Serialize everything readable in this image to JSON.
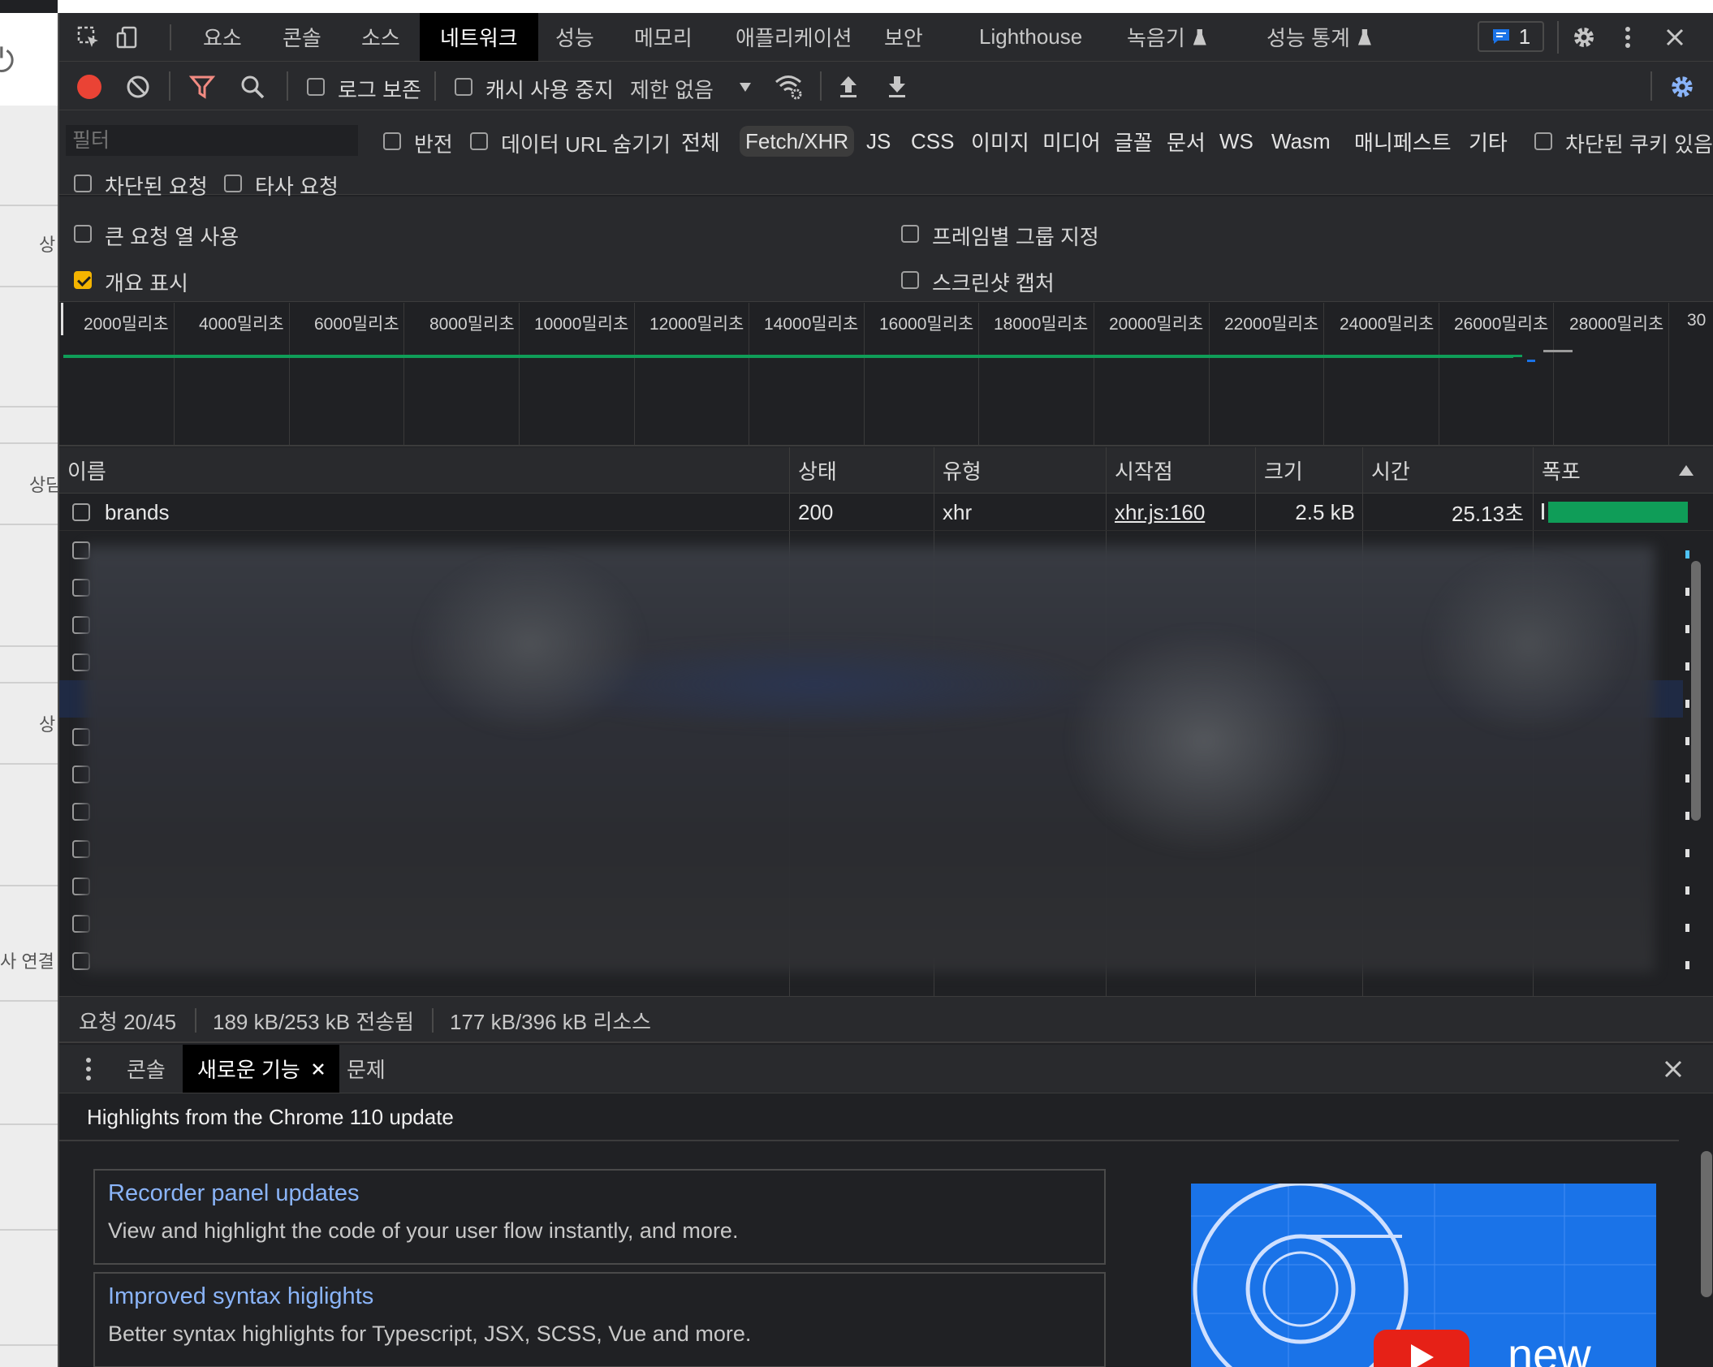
{
  "main_tabs": [
    "요소",
    "콘솔",
    "소스",
    "네트워크",
    "성능",
    "메모리",
    "애플리케이션",
    "보안",
    "Lighthouse",
    "녹음기",
    "성능 통계"
  ],
  "active_tab": "네트워크",
  "issues_count": "1",
  "toolbar": {
    "preserve_log": "로그 보존",
    "disable_cache": "캐시 사용 중지",
    "throttling": "제한 없음"
  },
  "filter": {
    "placeholder": "필터",
    "invert": "반전",
    "hide_data_urls": "데이터 URL 숨기기",
    "types": [
      "전체",
      "Fetch/XHR",
      "JS",
      "CSS",
      "이미지",
      "미디어",
      "글꼴",
      "문서",
      "WS",
      "Wasm",
      "매니페스트",
      "기타"
    ],
    "selected_type": "Fetch/XHR",
    "blocked_cookies": "차단된 쿠키 있음",
    "blocked_requests": "차단된 요청",
    "third_party": "타사 요청"
  },
  "settings": {
    "big_rows": "큰 요청 열 사용",
    "group_by_frame": "프레임별 그룹 지정",
    "show_overview": "개요 표시",
    "show_overview_checked": true,
    "capture_screenshots": "스크린샷 캡처"
  },
  "overview_ticks": [
    "2000밀리초",
    "4000밀리초",
    "6000밀리초",
    "8000밀리초",
    "10000밀리초",
    "12000밀리초",
    "14000밀리초",
    "16000밀리초",
    "18000밀리초",
    "20000밀리초",
    "22000밀리초",
    "24000밀리초",
    "26000밀리초",
    "28000밀리초",
    "30"
  ],
  "table": {
    "columns": [
      "이름",
      "상태",
      "유형",
      "시작점",
      "크기",
      "시간",
      "폭포"
    ],
    "first_row": {
      "name": "brands",
      "status": "200",
      "type": "xhr",
      "initiator": "xhr.js:160",
      "size": "2.5 kB",
      "time": "25.13초"
    }
  },
  "status_bar": {
    "requests": "요청 20/45",
    "transferred": "189 kB/253 kB 전송됨",
    "resources": "177 kB/396 kB 리소스"
  },
  "drawer": {
    "tabs": [
      "콘솔",
      "새로운 기능",
      "문제"
    ],
    "active": "새로운 기능"
  },
  "whats_new": {
    "heading": "Highlights from the Chrome 110 update",
    "cards": [
      {
        "title": "Recorder panel updates",
        "desc": "View and highlight the code of your user flow instantly, and more."
      },
      {
        "title": "Improved syntax higlights",
        "desc": "Better syntax highlights for Typescript, JSX, SCSS, Vue and more."
      }
    ],
    "promo_text": "new"
  },
  "left_page_fragments": [
    "상",
    "상담",
    "상",
    "사 연결"
  ],
  "colors": {
    "accent_green": "#0f9d58",
    "record_red": "#ea4335",
    "filter_red": "#f28b82",
    "link_blue": "#8ab4f8",
    "checkbox_orange": "#f4b400"
  }
}
